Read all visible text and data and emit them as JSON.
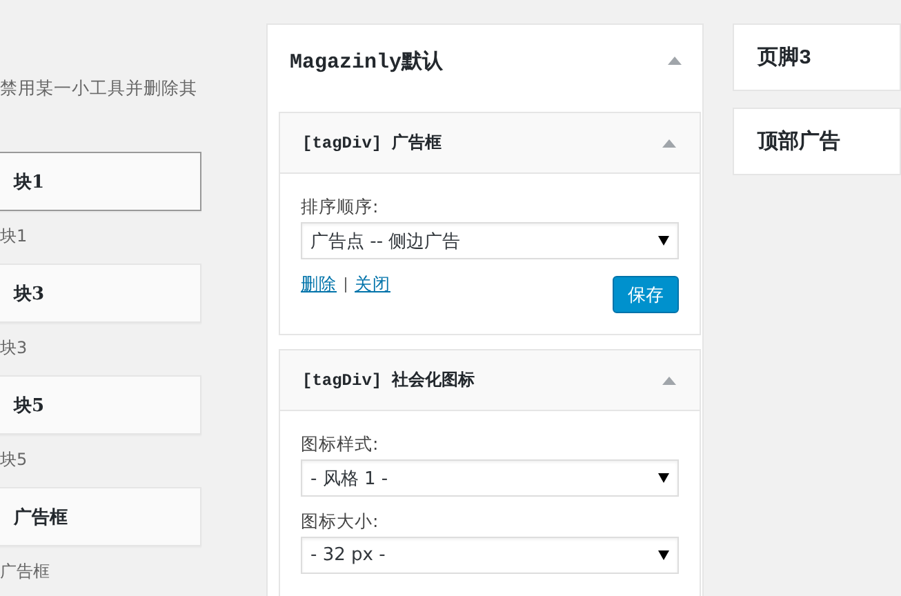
{
  "available": {
    "description": "禁用某一小工具并删除其",
    "widgets": [
      {
        "title": "块1",
        "description": "块1",
        "selected": true
      },
      {
        "title": "块3",
        "description": "块3",
        "selected": false
      },
      {
        "title": "块5",
        "description": "块5",
        "selected": false
      },
      {
        "title": "广告框",
        "description": "广告框",
        "selected": false
      }
    ]
  },
  "main_sidebar": {
    "title": "Magazinly默认",
    "widgets": [
      {
        "title": "[tagDiv] 广告框",
        "fields": [
          {
            "label": "排序顺序:",
            "value": "广告点 -- 侧边广告"
          }
        ],
        "actions": {
          "delete": "删除",
          "close": "关闭",
          "save": "保存"
        }
      },
      {
        "title": "[tagDiv] 社会化图标",
        "fields": [
          {
            "label": "图标样式:",
            "value": "- 风格 1 -"
          },
          {
            "label": "图标大小:",
            "value": "- 32 px -"
          }
        ]
      }
    ]
  },
  "other_sidebars": [
    {
      "title": "页脚3"
    },
    {
      "title": "顶部广告"
    }
  ]
}
